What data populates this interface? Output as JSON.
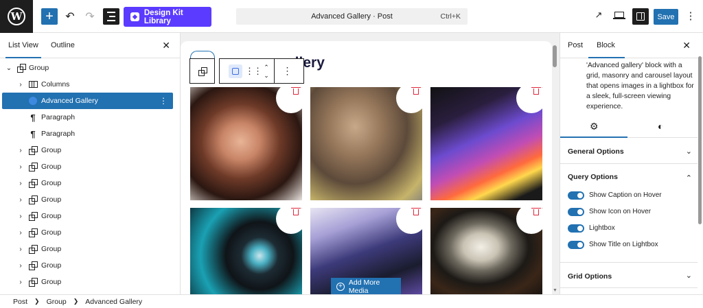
{
  "topbar": {
    "design_kit_label": "Design Kit Library",
    "command": {
      "title": "Advanced Gallery · Post",
      "shortcut": "Ctrl+K"
    },
    "save_label": "Save"
  },
  "left_panel": {
    "tabs": [
      "List View",
      "Outline"
    ],
    "tree": [
      {
        "label": "Group",
        "icon": "group-icon",
        "expanded": true
      },
      {
        "label": "Columns",
        "icon": "columns-icon"
      },
      {
        "label": "Advanced Gallery",
        "icon": "gallery-icon",
        "selected": true
      },
      {
        "label": "Paragraph",
        "icon": "paragraph-icon"
      },
      {
        "label": "Paragraph",
        "icon": "paragraph-icon"
      },
      {
        "label": "Group",
        "icon": "group-icon"
      },
      {
        "label": "Group",
        "icon": "group-icon"
      },
      {
        "label": "Group",
        "icon": "group-icon"
      },
      {
        "label": "Group",
        "icon": "group-icon"
      },
      {
        "label": "Group",
        "icon": "group-icon"
      },
      {
        "label": "Group",
        "icon": "group-icon"
      },
      {
        "label": "Group",
        "icon": "group-icon"
      },
      {
        "label": "Group",
        "icon": "group-icon"
      },
      {
        "label": "Group",
        "icon": "group-icon"
      }
    ]
  },
  "canvas": {
    "title_visible": "allery",
    "add_media_label": "Add More Media",
    "images": [
      "woman-portrait",
      "woman-sunlight",
      "laptop-neon",
      "headphones-teal",
      "game-controller",
      "wristwatch"
    ]
  },
  "right_panel": {
    "tabs": [
      "Post",
      "Block"
    ],
    "description": "'Advanced gallery' block with a grid, masonry and carousel layout that opens images in a lightbox for a sleek, full-screen viewing experience.",
    "sections": {
      "general": "General Options",
      "query": "Query Options",
      "grid": "Grid Options"
    },
    "toggles": [
      "Show Caption on Hover",
      "Show Icon on Hover",
      "Lightbox",
      "Show Title on Lightbox"
    ]
  },
  "breadcrumb": [
    "Post",
    "Group",
    "Advanced Gallery"
  ],
  "colors": {
    "accent": "#2271b1",
    "brand": "#5b3bff",
    "danger": "#e0263b"
  }
}
